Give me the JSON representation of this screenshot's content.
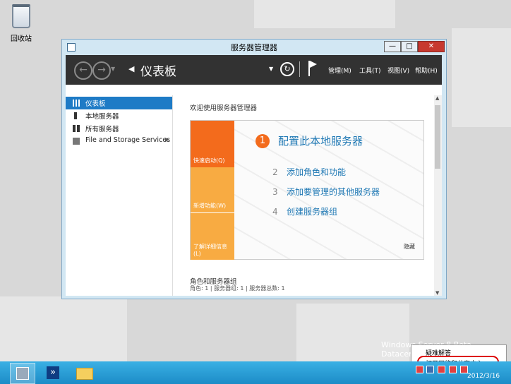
{
  "desktop": {
    "recycle_bin_label": "回收站",
    "watermark": "Windows Server 8 Beta Datacenter"
  },
  "window": {
    "title": "服务器管理器",
    "controls": {
      "minimize": "—",
      "maximize": "□",
      "close": "✕"
    }
  },
  "toolbar": {
    "breadcrumb": "仪表板",
    "menus": [
      "管理(M)",
      "工具(T)",
      "视图(V)",
      "帮助(H)"
    ]
  },
  "sidebar": {
    "items": [
      {
        "label": "仪表板",
        "icon": "dashboard-icon",
        "selected": true
      },
      {
        "label": "本地服务器",
        "icon": "server-icon",
        "selected": false
      },
      {
        "label": "所有服务器",
        "icon": "servers-icon",
        "selected": false
      },
      {
        "label": "File and Storage Services",
        "icon": "storage-icon",
        "selected": false,
        "has_chevron": true
      }
    ]
  },
  "main": {
    "welcome_title": "欢迎使用服务器管理器",
    "quickstart": {
      "tabs": [
        "快速启动(Q)",
        "新增功能(W)",
        "了解详细信息(L)"
      ],
      "step1_num": "1",
      "step1_title": "配置此本地服务器",
      "steps": [
        {
          "num": "2",
          "label": "添加角色和功能"
        },
        {
          "num": "3",
          "label": "添加要管理的其他服务器"
        },
        {
          "num": "4",
          "label": "创建服务器组"
        }
      ],
      "hide_label": "隐藏"
    },
    "roles_title": "角色和服务器组",
    "roles_summary": "角色: 1 | 服务器组: 1 | 服务器总数: 1"
  },
  "context_menu": {
    "items": [
      "疑难解答",
      "打开网络和共享中心"
    ]
  },
  "taskbar": {
    "date": "2012/3/16"
  },
  "colors": {
    "tab_orange": "#f36b1c",
    "tab_amber": "#f8ab42",
    "selected_blue": "#1e7bc6",
    "link_blue": "#1f78b4"
  }
}
